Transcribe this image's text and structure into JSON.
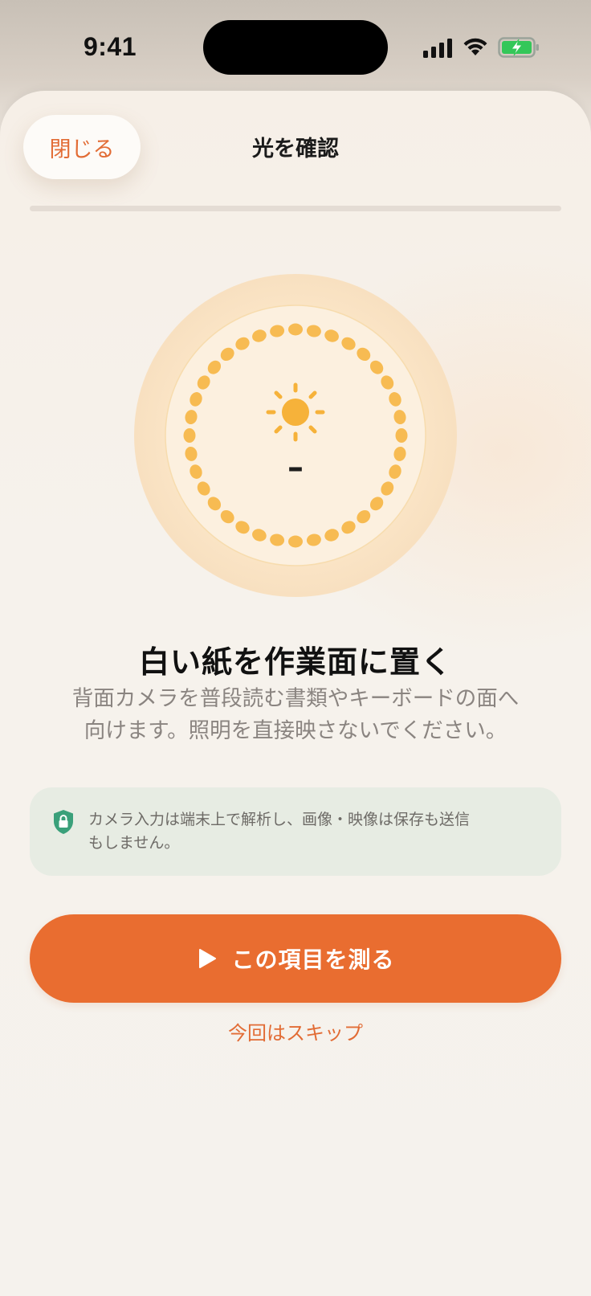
{
  "status_bar": {
    "time": "9:41"
  },
  "header": {
    "close_label": "閉じる",
    "title": "光を確認",
    "progress": 0
  },
  "gauge": {
    "value": "–",
    "icon": "sun-icon",
    "accent_color": "#f6b23a"
  },
  "step": {
    "heading": "白い紙を作業面に置く",
    "description_line1": "背面カメラを普段読む書類やキーボードの面へ",
    "description_line2": "向けます。照明を直接映さないでください。"
  },
  "privacy": {
    "icon": "shield-lock-icon",
    "line1": "カメラ入力は端末上で解析し、画像・映像は保存も送信",
    "line2": "もしません。"
  },
  "actions": {
    "measure_label": "この項目を測る",
    "skip_label": "今回はスキップ"
  },
  "colors": {
    "accent": "#e96d30",
    "shield": "#3aa07a",
    "note_bg": "#e7ece3"
  }
}
